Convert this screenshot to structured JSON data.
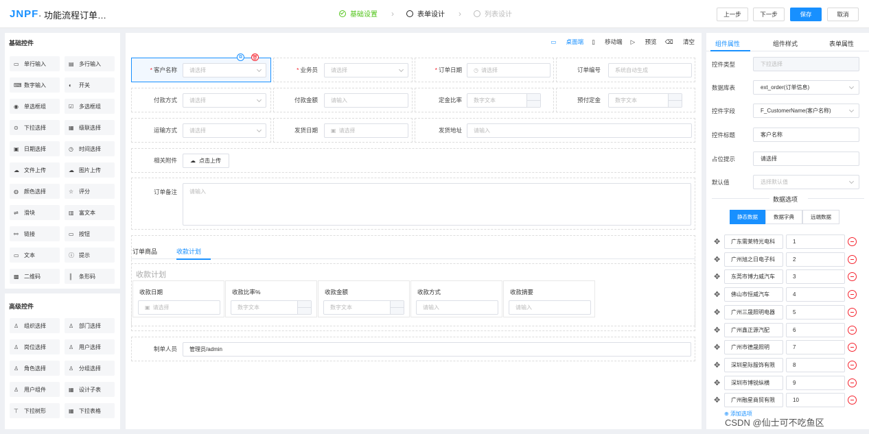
{
  "header": {
    "logo": "JNPF",
    "title": "· 功能流程订单…",
    "steps": [
      "基础设置",
      "表单设计",
      "列表设计"
    ],
    "buttons": {
      "prev": "上一步",
      "next": "下一步",
      "save": "保存",
      "cancel": "取消"
    }
  },
  "basic_controls": {
    "title": "基础控件",
    "items": [
      {
        "icon": "▭",
        "label": "单行输入"
      },
      {
        "icon": "▤",
        "label": "多行输入"
      },
      {
        "icon": "⌨",
        "label": "数字输入"
      },
      {
        "icon": "◐",
        "label": "开关"
      },
      {
        "icon": "◉",
        "label": "单选框组"
      },
      {
        "icon": "☑",
        "label": "多选框组"
      },
      {
        "icon": "⊙",
        "label": "下拉选择"
      },
      {
        "icon": "▦",
        "label": "级联选择"
      },
      {
        "icon": "▣",
        "label": "日期选择"
      },
      {
        "icon": "◷",
        "label": "时间选择"
      },
      {
        "icon": "☁",
        "label": "文件上传"
      },
      {
        "icon": "☁",
        "label": "图片上传"
      },
      {
        "icon": "◍",
        "label": "颜色选择"
      },
      {
        "icon": "☆",
        "label": "评分"
      },
      {
        "icon": "⇌",
        "label": "滑块"
      },
      {
        "icon": "▥",
        "label": "富文本"
      },
      {
        "icon": "⚯",
        "label": "链接"
      },
      {
        "icon": "▭",
        "label": "按钮"
      },
      {
        "icon": "▭",
        "label": "文本"
      },
      {
        "icon": "ⓘ",
        "label": "提示"
      },
      {
        "icon": "▩",
        "label": "二维码"
      },
      {
        "icon": "║",
        "label": "条形码"
      }
    ]
  },
  "advanced_controls": {
    "title": "高级控件",
    "items": [
      {
        "icon": "♙",
        "label": "组织选择"
      },
      {
        "icon": "♙",
        "label": "部门选择"
      },
      {
        "icon": "♙",
        "label": "岗位选择"
      },
      {
        "icon": "♙",
        "label": "用户选择"
      },
      {
        "icon": "♙",
        "label": "角色选择"
      },
      {
        "icon": "♙",
        "label": "分组选择"
      },
      {
        "icon": "♙",
        "label": "用户组件"
      },
      {
        "icon": "▦",
        "label": "设计子表"
      },
      {
        "icon": "⊤",
        "label": "下拉树形"
      },
      {
        "icon": "▦",
        "label": "下拉表格"
      }
    ]
  },
  "canvas": {
    "toolbar": [
      "桌面端",
      "移动端",
      "预览",
      "清空"
    ],
    "fields": {
      "customer": {
        "label": "客户名称",
        "placeholder": "请选择"
      },
      "salesman": {
        "label": "业务员",
        "placeholder": "请选择"
      },
      "order_date": {
        "label": "订单日期",
        "placeholder": "请选择"
      },
      "order_no": {
        "label": "订单编号",
        "placeholder": "系统自动生成"
      },
      "pay_method": {
        "label": "付款方式",
        "placeholder": "请选择"
      },
      "pay_amount": {
        "label": "付款金额",
        "placeholder": "请输入"
      },
      "deposit_ratio": {
        "label": "定金比率",
        "placeholder": "数字文本"
      },
      "deposit": {
        "label": "预付定金",
        "placeholder": "数字文本"
      },
      "ship_method": {
        "label": "运输方式",
        "placeholder": "请选择"
      },
      "ship_date": {
        "label": "发货日期",
        "placeholder": "请选择"
      },
      "ship_addr": {
        "label": "发货地址",
        "placeholder": "请输入"
      },
      "attachment": {
        "label": "相关附件",
        "button": "点击上传"
      },
      "remark": {
        "label": "订单备注",
        "placeholder": "请输入"
      },
      "creator": {
        "label": "制单人员",
        "value": "管理员/admin"
      }
    },
    "tabs": [
      "订单商品",
      "收款计划"
    ],
    "section_title": "收款计划",
    "table_cols": [
      {
        "header": "收款日期",
        "placeholder": "请选择"
      },
      {
        "header": "收款比率%",
        "placeholder": "数字文本"
      },
      {
        "header": "收款金额",
        "placeholder": "数字文本"
      },
      {
        "header": "收款方式",
        "placeholder": "请输入"
      },
      {
        "header": "收款摘要",
        "placeholder": "请输入"
      }
    ]
  },
  "props": {
    "tabs": [
      "组件属性",
      "组件样式",
      "表单属性"
    ],
    "rows": [
      {
        "label": "控件类型",
        "value": "下拉选择"
      },
      {
        "label": "数据库表",
        "value": "ext_order(订单信息)"
      },
      {
        "label": "控件字段",
        "value": "F_CustomerName(客户名称)"
      },
      {
        "label": "控件标题",
        "value": "客户名称"
      },
      {
        "label": "占位提示",
        "value": "请选择"
      },
      {
        "label": "默认值",
        "value": "选择默认值"
      }
    ],
    "options_title": "数据选项",
    "segments": [
      "静态数据",
      "数据字典",
      "远端数据"
    ],
    "options": [
      {
        "name": "广东需莱特光电科",
        "value": "1"
      },
      {
        "name": "广州旭之日电子科",
        "value": "2"
      },
      {
        "name": "东莞市博力威汽车",
        "value": "3"
      },
      {
        "name": "佛山市恒威汽车",
        "value": "4"
      },
      {
        "name": "广州三晟照明电器",
        "value": "5"
      },
      {
        "name": "广州鑫正源汽配",
        "value": "6"
      },
      {
        "name": "广州市德晟照明",
        "value": "7"
      },
      {
        "name": "深圳星际服饰有限",
        "value": "8"
      },
      {
        "name": "深圳市博锐纵横",
        "value": "9"
      },
      {
        "name": "广州融星商贸有限",
        "value": "10"
      }
    ],
    "add_option": "添加选项"
  },
  "watermark": "CSDN @仙士可不吃鱼区"
}
